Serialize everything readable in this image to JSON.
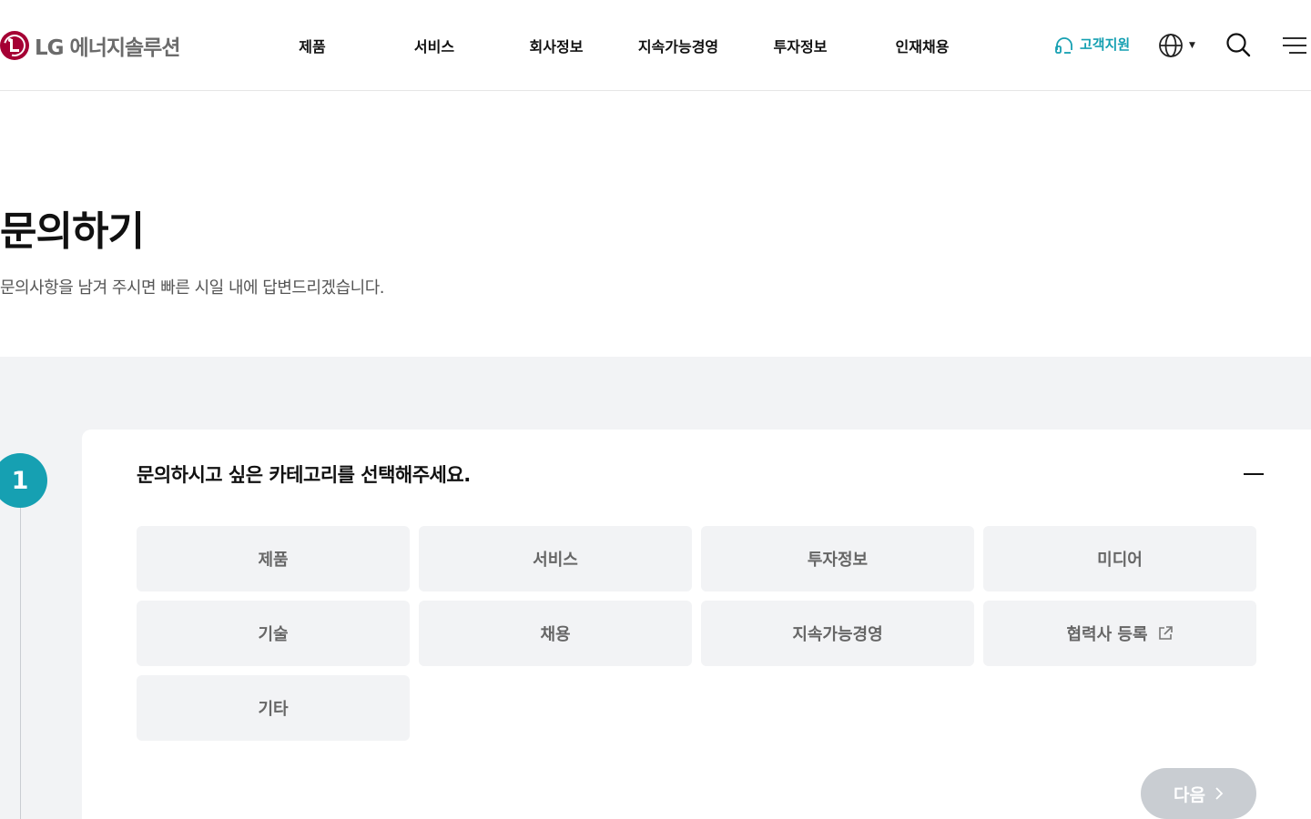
{
  "header": {
    "logo_text": "LG 에너지솔루션",
    "nav": [
      "제품",
      "서비스",
      "회사정보",
      "지속가능경영",
      "투자정보",
      "인재채용"
    ],
    "support_label": "고객지원",
    "lang_icon": "globe-icon",
    "search_icon": "search-icon",
    "menu_icon": "hamburger-menu-icon"
  },
  "page": {
    "title": "문의하기",
    "description": "문의사항을 남겨 주시면 빠른 시일 내에 답변드리겠습니다."
  },
  "step": {
    "number": "1",
    "title": "문의하시고 싶은 카테고리를 선택해주세요.",
    "categories": [
      "제품",
      "서비스",
      "투자정보",
      "미디어",
      "기술",
      "채용",
      "지속가능경영",
      "협력사 등록",
      "기타"
    ],
    "next_label": "다음"
  },
  "colors": {
    "brand": "#a50034",
    "accent": "#16a0b2",
    "section_bg": "#f2f3f5",
    "disabled_button": "#c9cdd2"
  }
}
